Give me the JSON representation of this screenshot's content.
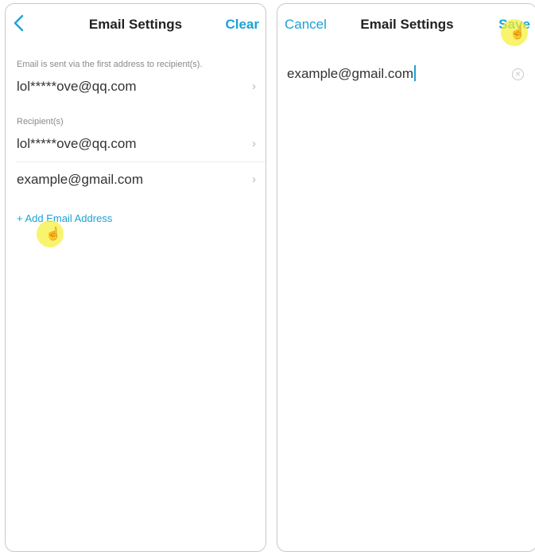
{
  "left_screen": {
    "header": {
      "title": "Email Settings",
      "clear_label": "Clear",
      "back_icon": "chevron-left-icon"
    },
    "sender_caption": "Email is sent via the first address to recipient(s).",
    "sender_address": "lol*****ove@qq.com",
    "recipients_caption": "Recipient(s)",
    "recipients": [
      {
        "address": "lol*****ove@qq.com"
      },
      {
        "address": "example@gmail.com"
      }
    ],
    "add_label": "+ Add Email Address"
  },
  "right_screen": {
    "header": {
      "title": "Email Settings",
      "cancel_label": "Cancel",
      "save_label": "Save"
    },
    "input_value": "example@gmail.com",
    "clear_icon": "clear-circle-icon"
  },
  "colors": {
    "accent": "#1aa3d6",
    "cursor_highlight": "#f6f03c"
  },
  "chevron_glyph": "›",
  "hand_cursor_glyph": "☝"
}
